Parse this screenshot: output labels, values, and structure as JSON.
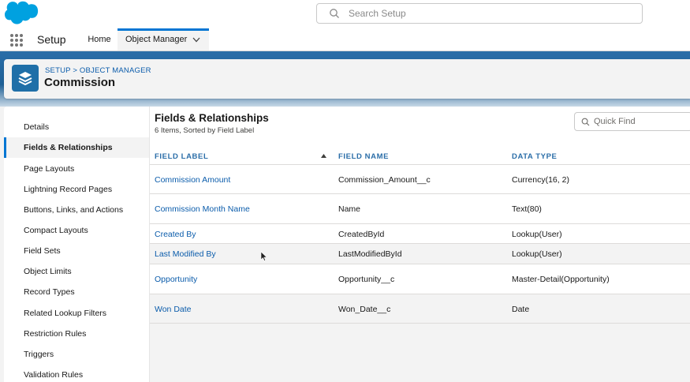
{
  "header": {
    "search_placeholder": "Search Setup"
  },
  "nav": {
    "app_name": "Setup",
    "tabs": [
      {
        "label": "Home"
      },
      {
        "label": "Object Manager"
      }
    ]
  },
  "page_header": {
    "breadcrumb": "SETUP > OBJECT MANAGER",
    "title": "Commission"
  },
  "sidebar": {
    "items": [
      {
        "label": "Details"
      },
      {
        "label": "Fields & Relationships"
      },
      {
        "label": "Page Layouts"
      },
      {
        "label": "Lightning Record Pages"
      },
      {
        "label": "Buttons, Links, and Actions"
      },
      {
        "label": "Compact Layouts"
      },
      {
        "label": "Field Sets"
      },
      {
        "label": "Object Limits"
      },
      {
        "label": "Record Types"
      },
      {
        "label": "Related Lookup Filters"
      },
      {
        "label": "Restriction Rules"
      },
      {
        "label": "Triggers"
      },
      {
        "label": "Validation Rules"
      }
    ],
    "active_index": 1
  },
  "main": {
    "title": "Fields & Relationships",
    "subtitle": "6 Items, Sorted by Field Label",
    "quick_find_placeholder": "Quick Find",
    "columns": [
      "FIELD LABEL",
      "FIELD NAME",
      "DATA TYPE"
    ],
    "rows": [
      {
        "label": "Commission Amount",
        "name": "Commission_Amount__c",
        "type": "Currency(16, 2)"
      },
      {
        "label": "Commission Month Name",
        "name": "Name",
        "type": "Text(80)"
      },
      {
        "label": "Created By",
        "name": "CreatedById",
        "type": "Lookup(User)"
      },
      {
        "label": "Last Modified By",
        "name": "LastModifiedById",
        "type": "Lookup(User)"
      },
      {
        "label": "Opportunity",
        "name": "Opportunity__c",
        "type": "Master-Detail(Opportunity)"
      },
      {
        "label": "Won Date",
        "name": "Won_Date__c",
        "type": "Date"
      }
    ]
  },
  "colors": {
    "brand_blue": "#0176d3",
    "link_blue": "#0b5cab",
    "banner_blue": "#2b6ea8"
  }
}
